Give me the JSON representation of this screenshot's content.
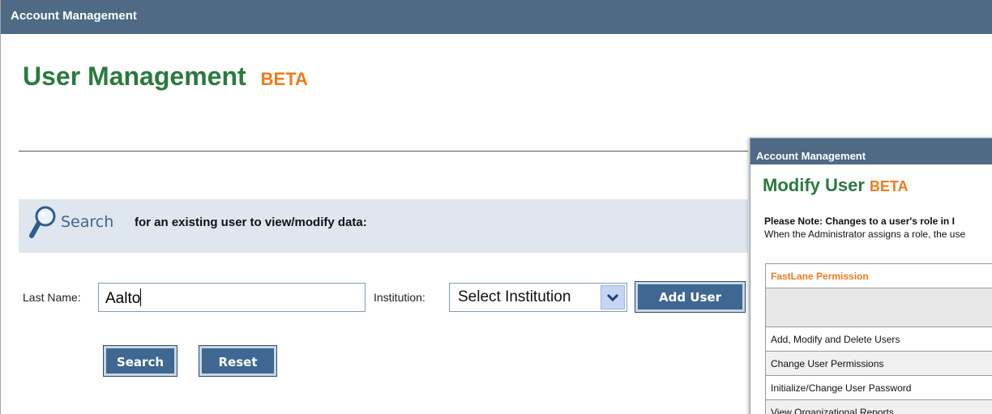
{
  "header": {
    "title": "Account Management"
  },
  "page": {
    "title": "User Management",
    "badge": "BETA"
  },
  "search": {
    "heading": "Search",
    "description": "for an existing user to view/modify data:",
    "last_name_label": "Last Name:",
    "last_name_value": "Aalto",
    "institution_label": "Institution:",
    "institution_selected": "Select Institution",
    "add_user_label": "Add User",
    "search_label": "Search",
    "reset_label": "Reset"
  },
  "overlay": {
    "header": "Account Management",
    "title": "Modify User",
    "badge": "BETA",
    "note_bold": "Please Note: Changes to a user's role in I",
    "note_text": "When the Administrator assigns a role, the use",
    "table_header": "FastLane Permission",
    "rows": [
      "Add, Modify and Delete Users",
      "Change User Permissions",
      "Initialize/Change User Password",
      "View Organizational Reports"
    ]
  },
  "colors": {
    "header_bg": "#4e6a84",
    "title_green": "#2a7a3e",
    "beta_orange": "#f07a19",
    "button_blue": "#3e6792"
  }
}
